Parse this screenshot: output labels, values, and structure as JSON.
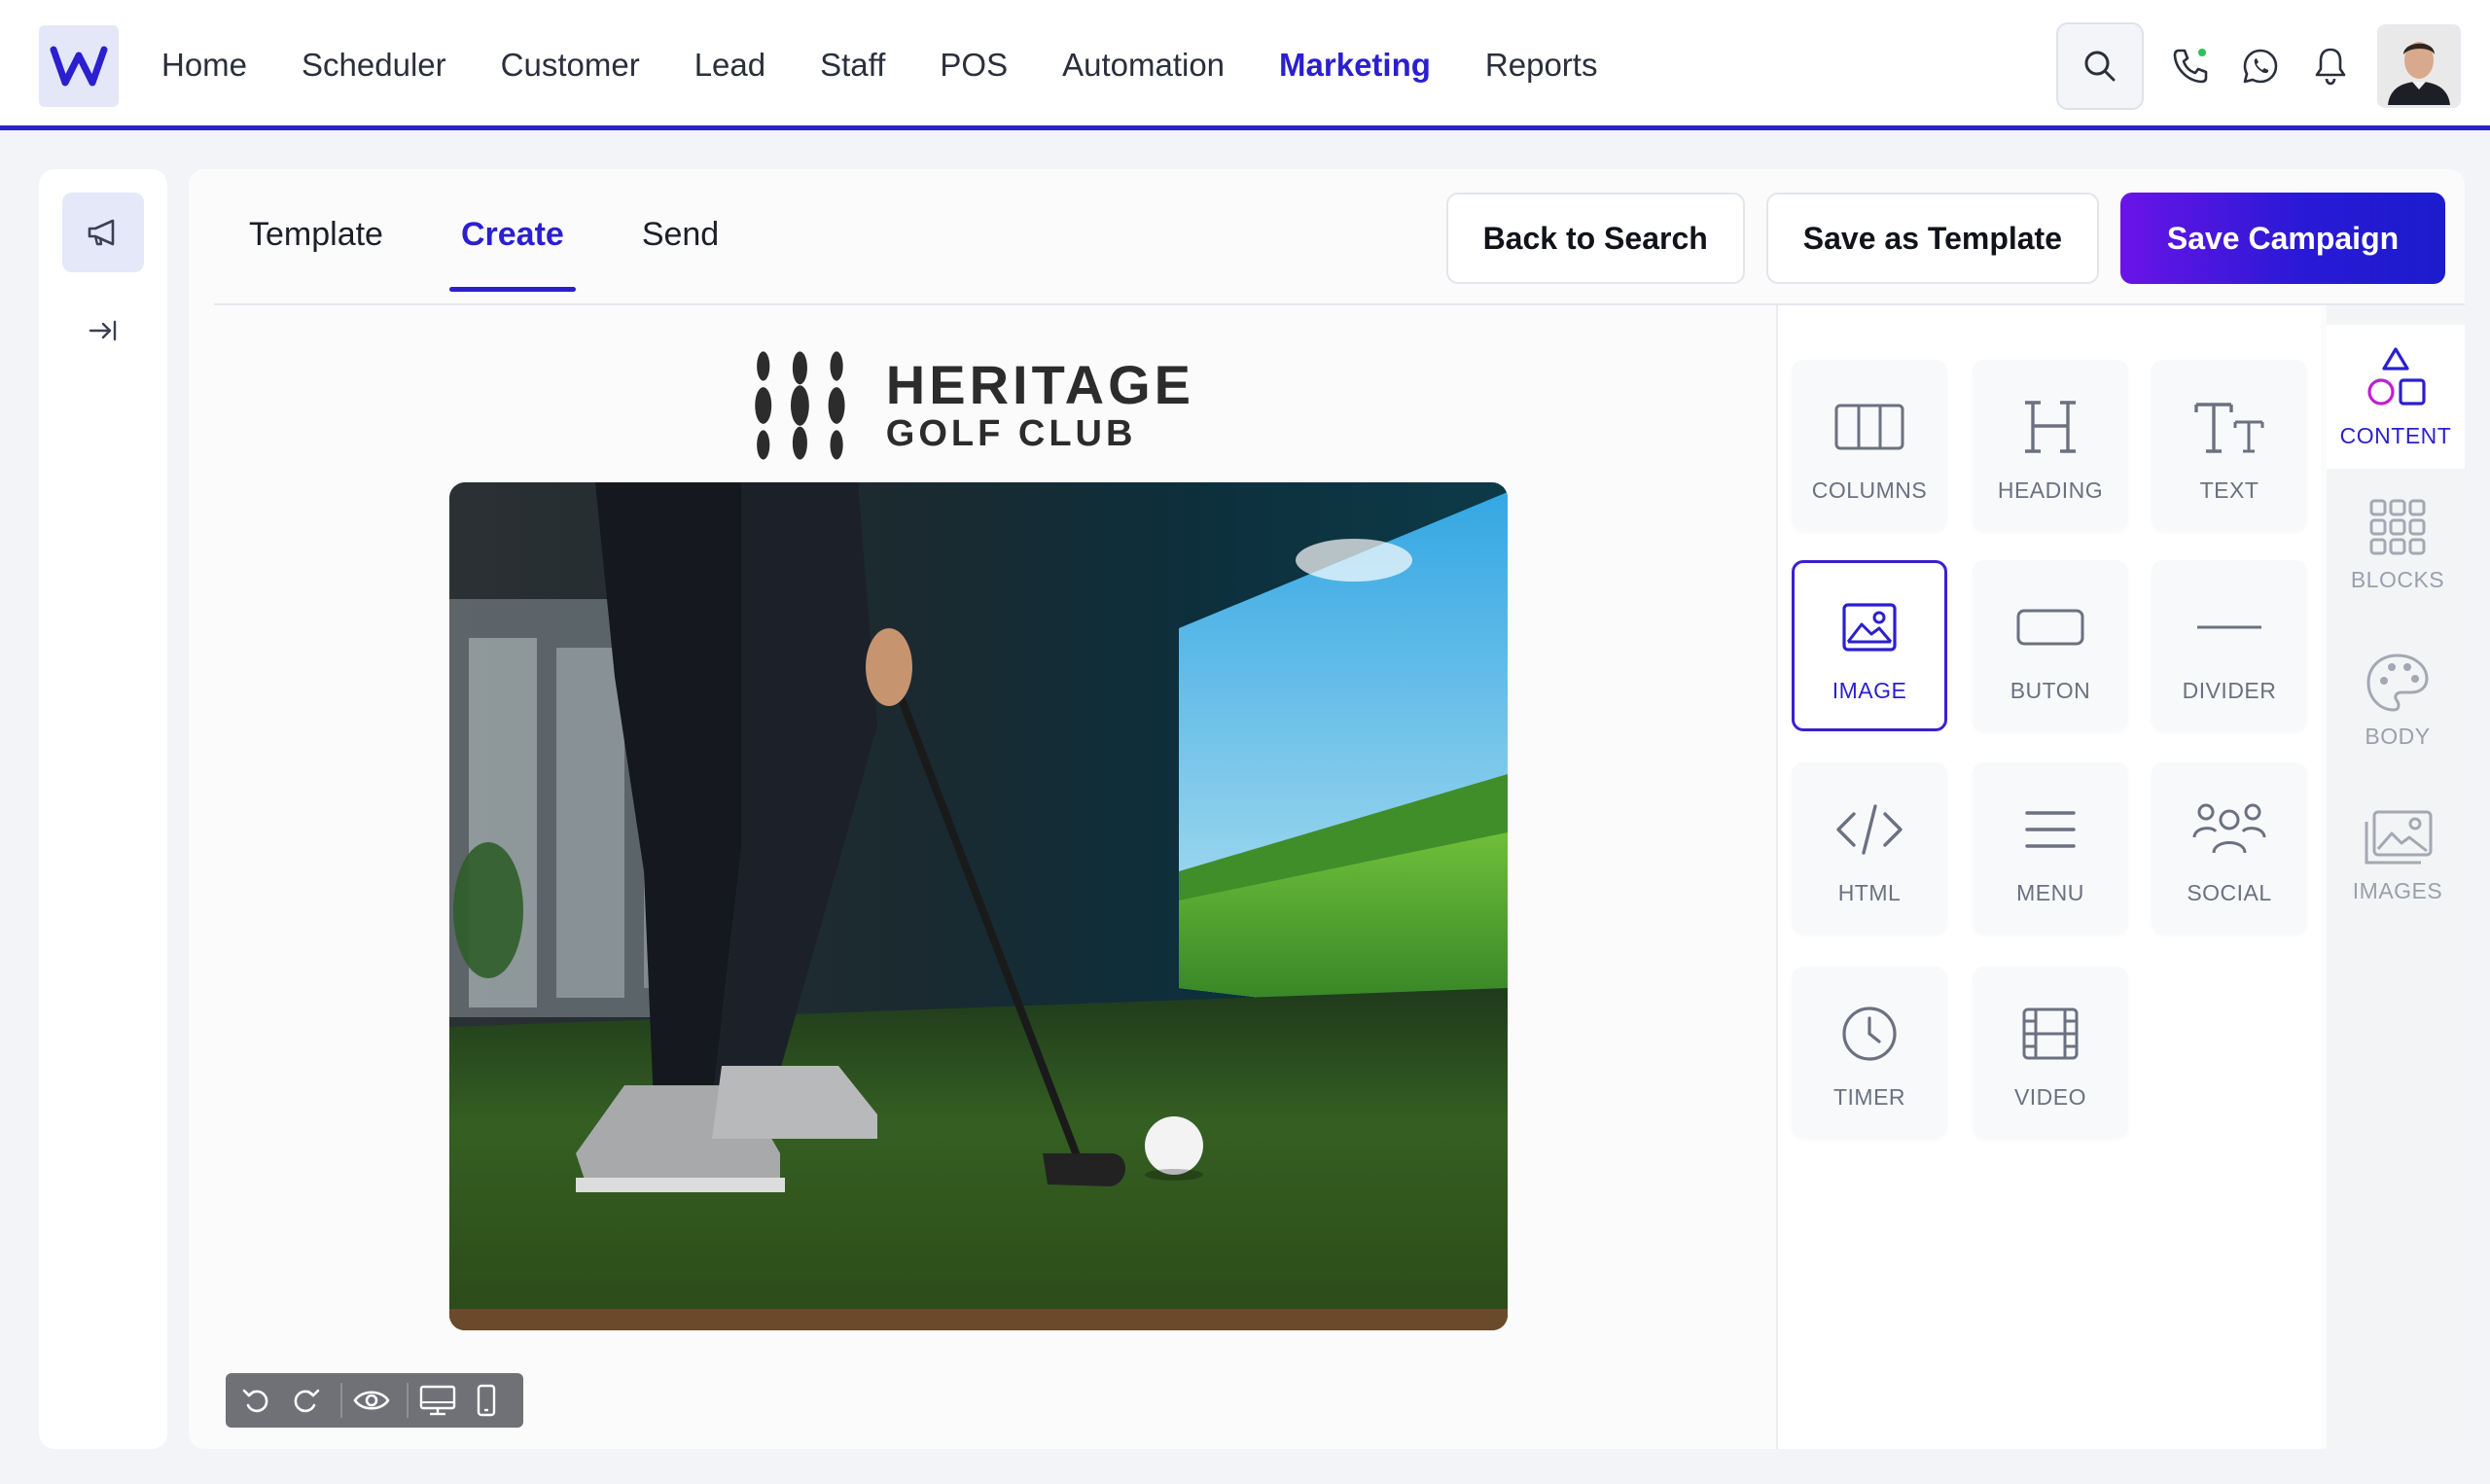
{
  "nav": {
    "items": [
      {
        "label": "Home"
      },
      {
        "label": "Scheduler"
      },
      {
        "label": "Customer"
      },
      {
        "label": "Lead"
      },
      {
        "label": "Staff"
      },
      {
        "label": "POS"
      },
      {
        "label": "Automation"
      },
      {
        "label": "Marketing",
        "active": true
      },
      {
        "label": "Reports"
      }
    ]
  },
  "editor": {
    "tabs": [
      {
        "label": "Template"
      },
      {
        "label": "Create",
        "active": true
      },
      {
        "label": "Send"
      }
    ],
    "actions": {
      "back": "Back to Search",
      "save_template": "Save as Template",
      "save_campaign": "Save Campaign"
    }
  },
  "canvas": {
    "brand_title": "HERITAGE",
    "brand_subtitle": "GOLF CLUB"
  },
  "tools": [
    {
      "label": "COLUMNS",
      "icon": "columns-icon"
    },
    {
      "label": "HEADING",
      "icon": "heading-icon"
    },
    {
      "label": "TEXT",
      "icon": "text-icon"
    },
    {
      "label": "IMAGE",
      "icon": "image-icon",
      "selected": true
    },
    {
      "label": "BUTON",
      "icon": "button-icon"
    },
    {
      "label": "DIVIDER",
      "icon": "divider-icon"
    },
    {
      "label": "HTML",
      "icon": "code-icon"
    },
    {
      "label": "MENU",
      "icon": "menu-icon"
    },
    {
      "label": "SOCIAL",
      "icon": "people-icon"
    },
    {
      "label": "TIMER",
      "icon": "clock-icon"
    },
    {
      "label": "VIDEO",
      "icon": "film-icon"
    }
  ],
  "sidetabs": [
    {
      "label": "CONTENT",
      "icon": "shapes-icon",
      "active": true
    },
    {
      "label": "BLOCKS",
      "icon": "grid-icon"
    },
    {
      "label": "BODY",
      "icon": "palette-icon"
    },
    {
      "label": "IMAGES",
      "icon": "images-icon"
    }
  ],
  "colors": {
    "accent": "#2b1fd0",
    "accent_gradient_start": "#6a14e6",
    "status_online": "#2fbf5b"
  }
}
